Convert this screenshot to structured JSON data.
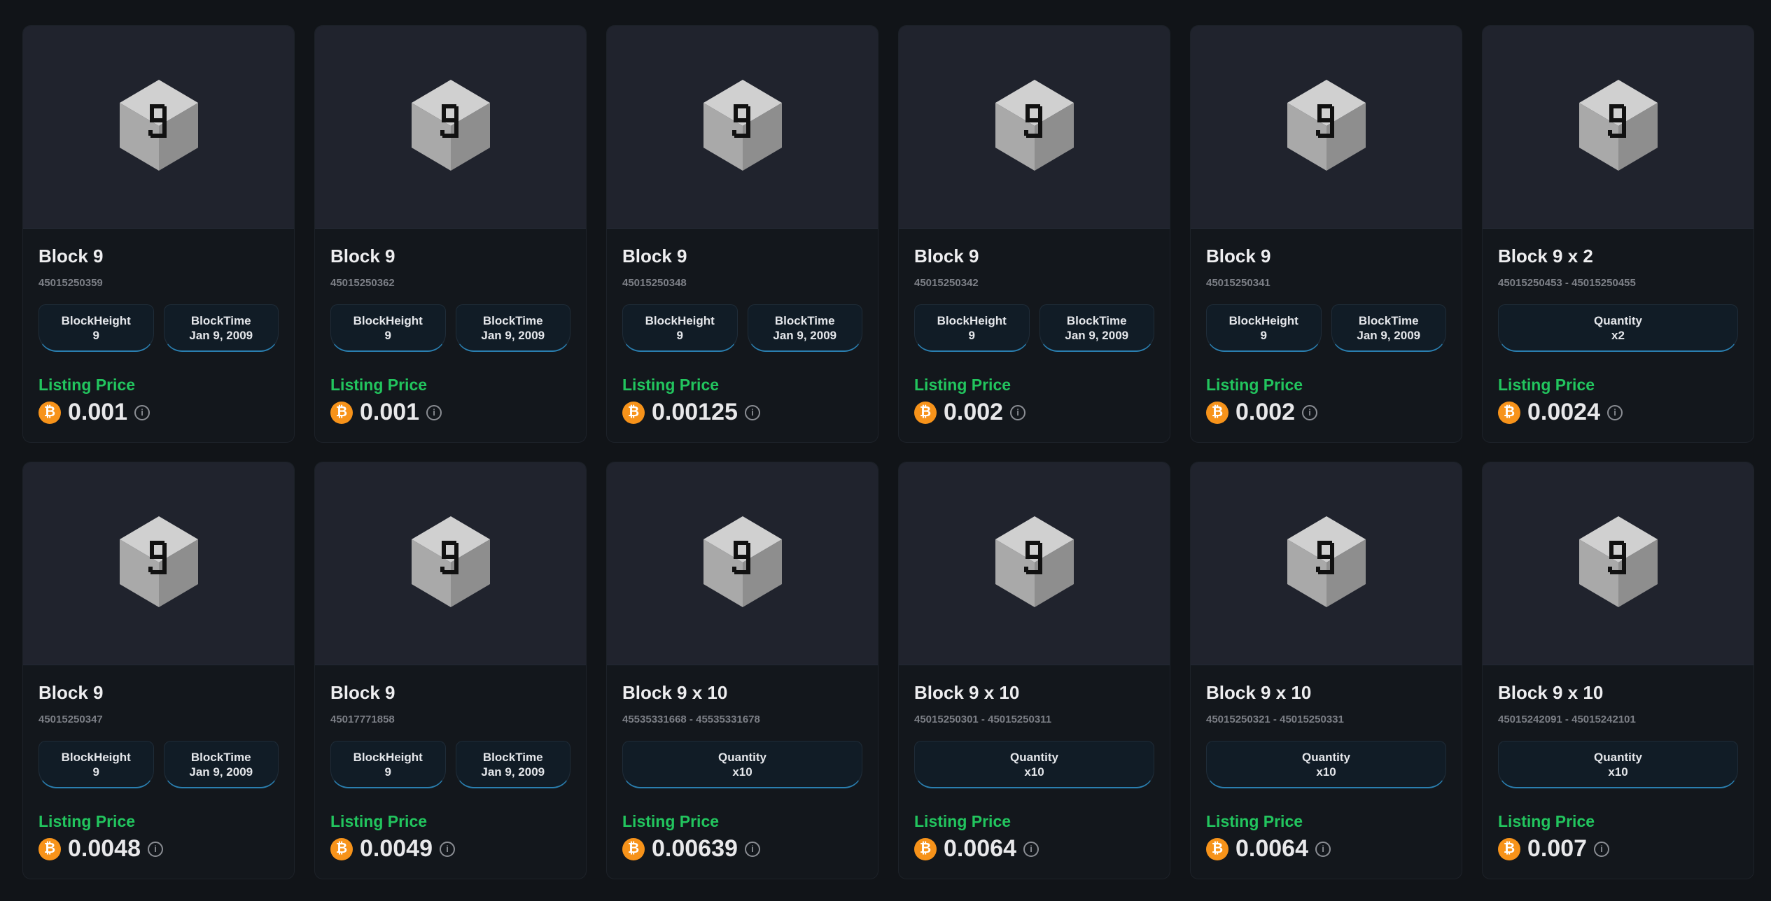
{
  "labels": {
    "block_height": "BlockHeight",
    "block_time": "BlockTime",
    "quantity": "Quantity",
    "listing_price": "Listing Price"
  },
  "icons": {
    "currency": "bitcoin-icon",
    "info": "info-icon",
    "thumb": "block-cube-icon"
  },
  "colors": {
    "accent_green": "#22c55e",
    "bitcoin": "#f7931a",
    "background": "#111418"
  },
  "cards": [
    {
      "title": "Block 9",
      "id": "45015250359",
      "height": "9",
      "time": "Jan 9, 2009",
      "price": "0.001"
    },
    {
      "title": "Block 9",
      "id": "45015250362",
      "height": "9",
      "time": "Jan 9, 2009",
      "price": "0.001"
    },
    {
      "title": "Block 9",
      "id": "45015250348",
      "height": "9",
      "time": "Jan 9, 2009",
      "price": "0.00125"
    },
    {
      "title": "Block 9",
      "id": "45015250342",
      "height": "9",
      "time": "Jan 9, 2009",
      "price": "0.002"
    },
    {
      "title": "Block 9",
      "id": "45015250341",
      "height": "9",
      "time": "Jan 9, 2009",
      "price": "0.002"
    },
    {
      "title": "Block 9 x 2",
      "id": "45015250453 - 45015250455",
      "quantity": "x2",
      "price": "0.0024"
    },
    {
      "title": "Block 9",
      "id": "45015250347",
      "height": "9",
      "time": "Jan 9, 2009",
      "price": "0.0048"
    },
    {
      "title": "Block 9",
      "id": "45017771858",
      "height": "9",
      "time": "Jan 9, 2009",
      "price": "0.0049"
    },
    {
      "title": "Block 9 x 10",
      "id": "45535331668 - 45535331678",
      "quantity": "x10",
      "price": "0.00639"
    },
    {
      "title": "Block 9 x 10",
      "id": "45015250301 - 45015250311",
      "quantity": "x10",
      "price": "0.0064"
    },
    {
      "title": "Block 9 x 10",
      "id": "45015250321 - 45015250331",
      "quantity": "x10",
      "price": "0.0064"
    },
    {
      "title": "Block 9 x 10",
      "id": "45015242091 - 45015242101",
      "quantity": "x10",
      "price": "0.007"
    }
  ]
}
